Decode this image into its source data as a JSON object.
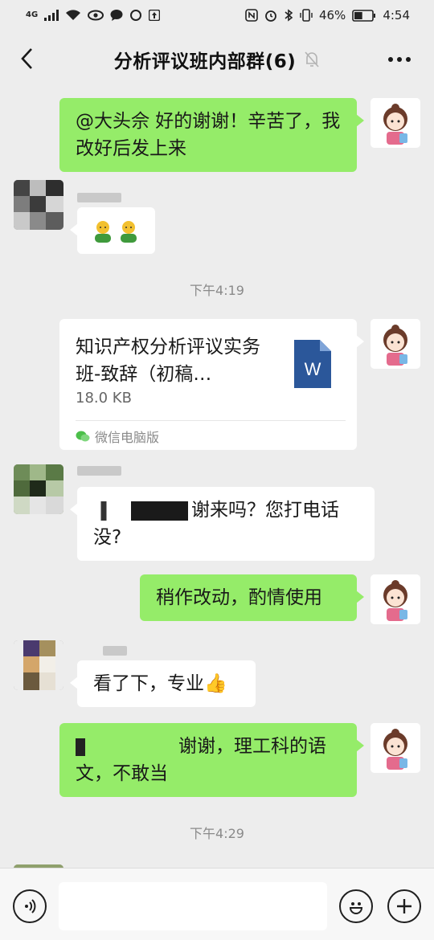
{
  "status_bar": {
    "network": "4G",
    "battery_percent": "46%",
    "battery_level": 0.46,
    "time": "4:54"
  },
  "nav": {
    "title": "分析评议班内部群(6)",
    "back_icon": "chevron-left-icon",
    "mute_icon": "bell-off-icon",
    "more_icon": "more-dots-icon"
  },
  "messages": [
    {
      "side": "right",
      "type": "text",
      "text": "@大头佘  好的谢谢！辛苦了，我改好后发上来"
    },
    {
      "side": "left",
      "type": "emoji",
      "text": ""
    },
    {
      "type": "time",
      "text": "下午4:19"
    },
    {
      "side": "right",
      "type": "file",
      "file_name": "知识产权分析评议实务班-致辞（初稿…",
      "file_size": "18.0 KB",
      "source": "微信电脑版"
    },
    {
      "side": "left",
      "type": "text",
      "text": "谢来吗？您打电话没?"
    },
    {
      "side": "right",
      "type": "text",
      "text": "稍作改动，酌情使用"
    },
    {
      "side": "left",
      "type": "text",
      "text": "看了下，专业👍"
    },
    {
      "side": "right",
      "type": "text",
      "text": "谢谢，理工科的语文，不敢当"
    },
    {
      "type": "time",
      "text": "下午4:29"
    }
  ],
  "input_bar": {
    "voice_icon": "voice-icon",
    "emoji_icon": "smiley-icon",
    "plus_icon": "plus-icon"
  },
  "colors": {
    "background": "#ededed",
    "bubble_self": "#95ec69",
    "bubble_other": "#ffffff",
    "word_blue": "#2b579a"
  }
}
